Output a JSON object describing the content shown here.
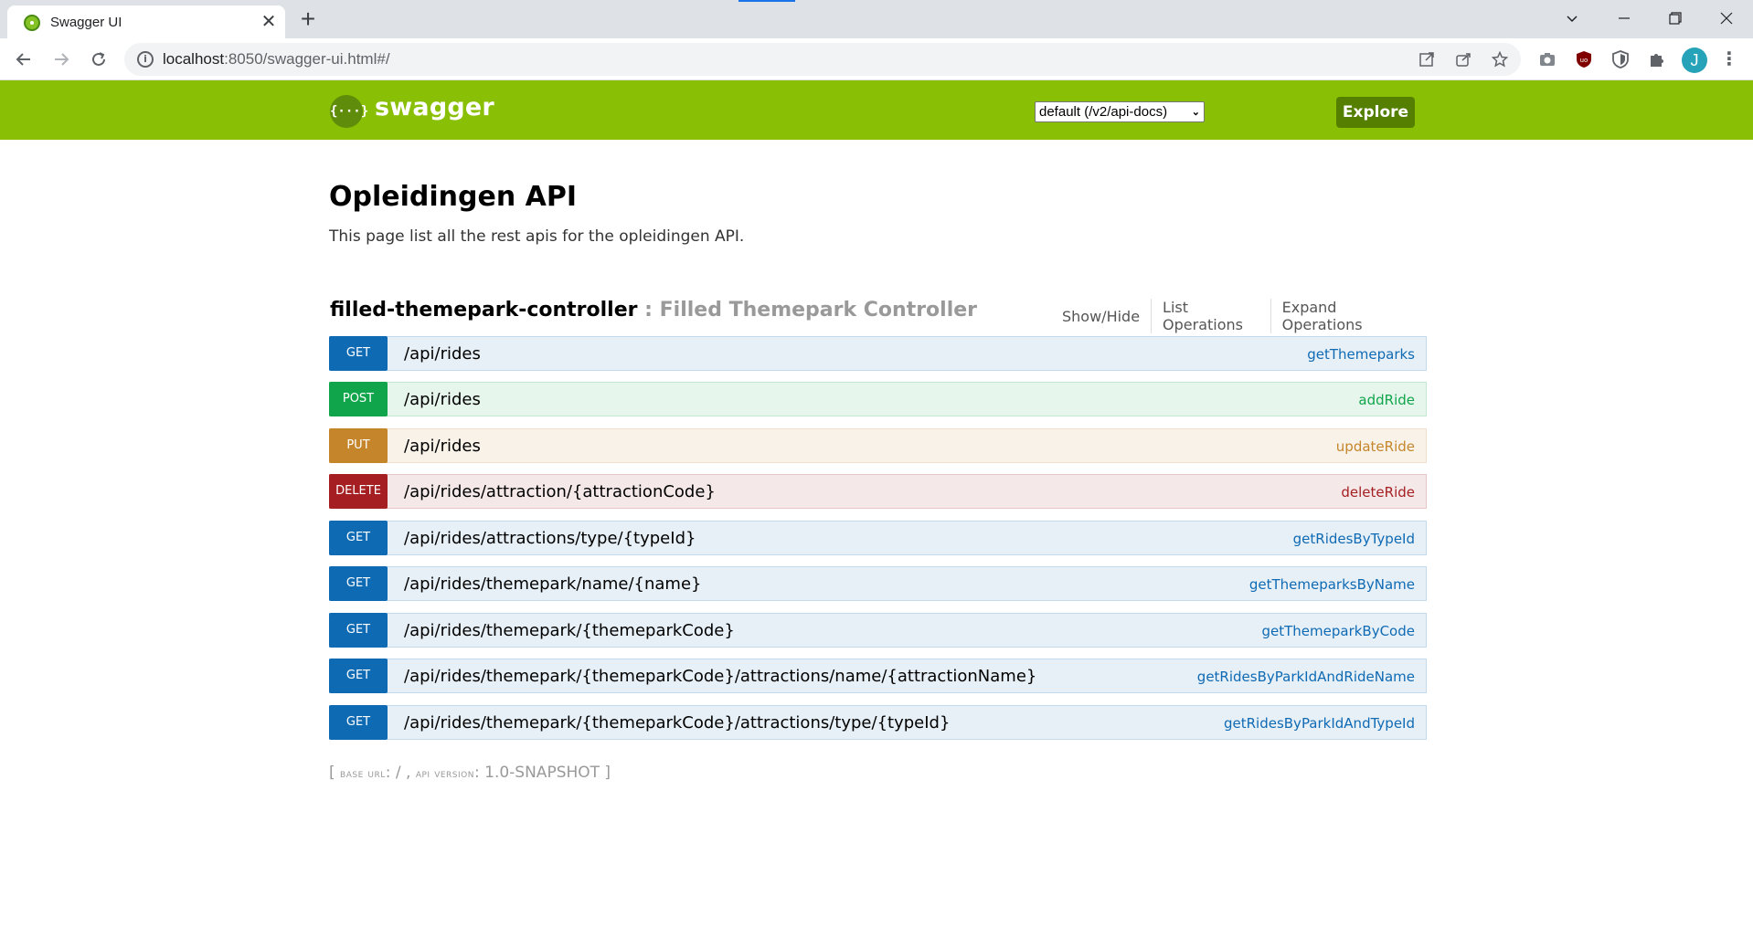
{
  "browser": {
    "tab_title": "Swagger UI",
    "url_host": "localhost",
    "url_rest": ":8050/swagger-ui.html#/",
    "avatar_initial": "J"
  },
  "header": {
    "logo_icon": "{···}",
    "logo_text": "swagger",
    "select_value": "default (/v2/api-docs)",
    "explore_label": "Explore"
  },
  "info": {
    "title": "Opleidingen API",
    "description": "This page list all the rest apis for the opleidingen API."
  },
  "controller": {
    "name": "filled-themepark-controller",
    "separator": " : ",
    "description": "Filled Themepark Controller",
    "links": [
      "Show/Hide",
      "List Operations",
      "Expand Operations"
    ]
  },
  "operations": [
    {
      "method": "GET",
      "path": "/api/rides",
      "nickname": "getThemeparks"
    },
    {
      "method": "POST",
      "path": "/api/rides",
      "nickname": "addRide"
    },
    {
      "method": "PUT",
      "path": "/api/rides",
      "nickname": "updateRide"
    },
    {
      "method": "DELETE",
      "path": "/api/rides/attraction/{attractionCode}",
      "nickname": "deleteRide"
    },
    {
      "method": "GET",
      "path": "/api/rides/attractions/type/{typeId}",
      "nickname": "getRidesByTypeId"
    },
    {
      "method": "GET",
      "path": "/api/rides/themepark/name/{name}",
      "nickname": "getThemeparksByName"
    },
    {
      "method": "GET",
      "path": "/api/rides/themepark/{themeparkCode}",
      "nickname": "getThemeparkByCode"
    },
    {
      "method": "GET",
      "path": "/api/rides/themepark/{themeparkCode}/attractions/name/{attractionName}",
      "nickname": "getRidesByParkIdAndRideName"
    },
    {
      "method": "GET",
      "path": "/api/rides/themepark/{themeparkCode}/attractions/type/{typeId}",
      "nickname": "getRidesByParkIdAndTypeId"
    }
  ],
  "footer": {
    "open_bracket": "[ ",
    "base_url_label": "base url",
    "base_url_value": ": / , ",
    "api_version_label": "api version",
    "api_version_value": ": 1.0-SNAPSHOT ]"
  }
}
